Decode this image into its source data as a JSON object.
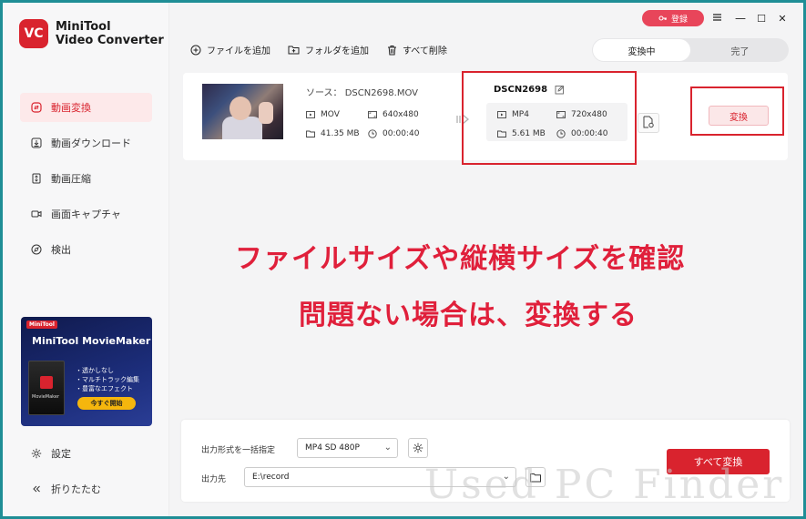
{
  "app": {
    "logo_badge": "VC",
    "name_line1": "MiniTool",
    "name_line2": "Video Converter"
  },
  "titlebar": {
    "login_label": "登録",
    "menu_icon": "hamburger-icon",
    "minimize": "—",
    "maximize": "☐",
    "close": "✕"
  },
  "sidebar": {
    "items": [
      {
        "label": "動画変換",
        "icon": "convert-icon",
        "active": true
      },
      {
        "label": "動画ダウンロード",
        "icon": "download-icon",
        "active": false
      },
      {
        "label": "動画圧縮",
        "icon": "compress-icon",
        "active": false
      },
      {
        "label": "画面キャプチャ",
        "icon": "camera-icon",
        "active": false
      },
      {
        "label": "検出",
        "icon": "compass-icon",
        "active": false
      }
    ],
    "settings_label": "設定",
    "collapse_label": "折りたたむ"
  },
  "ad": {
    "badge": "MiniTool",
    "title": "MiniTool MovieMaker",
    "box_label": "MovieMaker",
    "features": [
      "・透かしなし",
      "・マルチトラック編集",
      "・豊富なエフェクト"
    ],
    "cta": "今すぐ開始"
  },
  "toolbar": {
    "add_file": "ファイルを追加",
    "add_folder": "フォルダを追加",
    "delete_all": "すべて削除",
    "tab_converting": "変換中",
    "tab_done": "完了"
  },
  "file": {
    "source_label": "ソース：",
    "source_name": "DSCN2698.MOV",
    "source_format": "MOV",
    "source_resolution": "640x480",
    "source_size": "41.35 MB",
    "source_duration": "00:00:40",
    "target_name": "DSCN2698",
    "target_format": "MP4",
    "target_resolution": "720x480",
    "target_size": "5.61 MB",
    "target_duration": "00:00:40",
    "convert_label": "変換"
  },
  "annotation": {
    "line1": "ファイルサイズや縦横サイズを確認",
    "line2": "問題ない場合は、変換する",
    "color": "#e0203b"
  },
  "bottom": {
    "format_label": "出力形式を一括指定",
    "format_value": "MP4 SD 480P",
    "output_label": "出力先",
    "output_path": "E:\\record",
    "convert_all": "すべて変換"
  },
  "watermark": "Used PC Finder",
  "colors": {
    "accent": "#d9232e",
    "frame": "#1f8e96"
  }
}
